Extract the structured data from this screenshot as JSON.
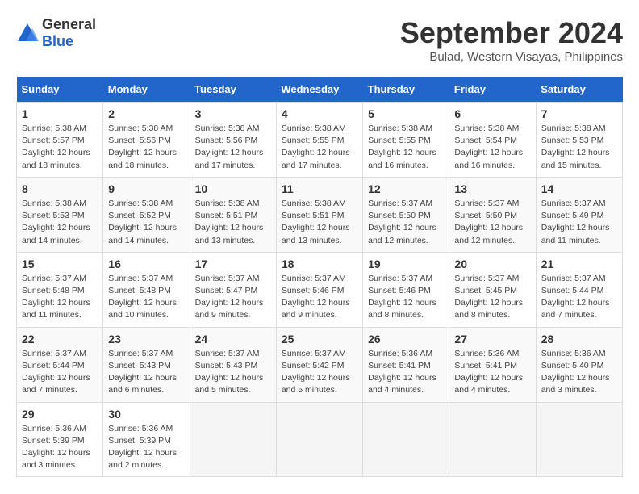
{
  "header": {
    "logo": {
      "general": "General",
      "blue": "Blue"
    },
    "title": "September 2024",
    "location": "Bulad, Western Visayas, Philippines"
  },
  "calendar": {
    "days_of_week": [
      "Sunday",
      "Monday",
      "Tuesday",
      "Wednesday",
      "Thursday",
      "Friday",
      "Saturday"
    ],
    "weeks": [
      [
        {
          "date": null,
          "info": null
        },
        {
          "date": null,
          "info": null
        },
        {
          "date": null,
          "info": null
        },
        {
          "date": null,
          "info": null
        },
        {
          "date": null,
          "info": null
        },
        {
          "date": null,
          "info": null
        },
        {
          "date": null,
          "info": null
        }
      ],
      [
        {
          "date": "1",
          "info": "Sunrise: 5:38 AM\nSunset: 5:57 PM\nDaylight: 12 hours and 18 minutes."
        },
        {
          "date": "2",
          "info": "Sunrise: 5:38 AM\nSunset: 5:56 PM\nDaylight: 12 hours and 18 minutes."
        },
        {
          "date": "3",
          "info": "Sunrise: 5:38 AM\nSunset: 5:56 PM\nDaylight: 12 hours and 17 minutes."
        },
        {
          "date": "4",
          "info": "Sunrise: 5:38 AM\nSunset: 5:55 PM\nDaylight: 12 hours and 17 minutes."
        },
        {
          "date": "5",
          "info": "Sunrise: 5:38 AM\nSunset: 5:55 PM\nDaylight: 12 hours and 16 minutes."
        },
        {
          "date": "6",
          "info": "Sunrise: 5:38 AM\nSunset: 5:54 PM\nDaylight: 12 hours and 16 minutes."
        },
        {
          "date": "7",
          "info": "Sunrise: 5:38 AM\nSunset: 5:53 PM\nDaylight: 12 hours and 15 minutes."
        }
      ],
      [
        {
          "date": "8",
          "info": "Sunrise: 5:38 AM\nSunset: 5:53 PM\nDaylight: 12 hours and 14 minutes."
        },
        {
          "date": "9",
          "info": "Sunrise: 5:38 AM\nSunset: 5:52 PM\nDaylight: 12 hours and 14 minutes."
        },
        {
          "date": "10",
          "info": "Sunrise: 5:38 AM\nSunset: 5:51 PM\nDaylight: 12 hours and 13 minutes."
        },
        {
          "date": "11",
          "info": "Sunrise: 5:38 AM\nSunset: 5:51 PM\nDaylight: 12 hours and 13 minutes."
        },
        {
          "date": "12",
          "info": "Sunrise: 5:37 AM\nSunset: 5:50 PM\nDaylight: 12 hours and 12 minutes."
        },
        {
          "date": "13",
          "info": "Sunrise: 5:37 AM\nSunset: 5:50 PM\nDaylight: 12 hours and 12 minutes."
        },
        {
          "date": "14",
          "info": "Sunrise: 5:37 AM\nSunset: 5:49 PM\nDaylight: 12 hours and 11 minutes."
        }
      ],
      [
        {
          "date": "15",
          "info": "Sunrise: 5:37 AM\nSunset: 5:48 PM\nDaylight: 12 hours and 11 minutes."
        },
        {
          "date": "16",
          "info": "Sunrise: 5:37 AM\nSunset: 5:48 PM\nDaylight: 12 hours and 10 minutes."
        },
        {
          "date": "17",
          "info": "Sunrise: 5:37 AM\nSunset: 5:47 PM\nDaylight: 12 hours and 9 minutes."
        },
        {
          "date": "18",
          "info": "Sunrise: 5:37 AM\nSunset: 5:46 PM\nDaylight: 12 hours and 9 minutes."
        },
        {
          "date": "19",
          "info": "Sunrise: 5:37 AM\nSunset: 5:46 PM\nDaylight: 12 hours and 8 minutes."
        },
        {
          "date": "20",
          "info": "Sunrise: 5:37 AM\nSunset: 5:45 PM\nDaylight: 12 hours and 8 minutes."
        },
        {
          "date": "21",
          "info": "Sunrise: 5:37 AM\nSunset: 5:44 PM\nDaylight: 12 hours and 7 minutes."
        }
      ],
      [
        {
          "date": "22",
          "info": "Sunrise: 5:37 AM\nSunset: 5:44 PM\nDaylight: 12 hours and 7 minutes."
        },
        {
          "date": "23",
          "info": "Sunrise: 5:37 AM\nSunset: 5:43 PM\nDaylight: 12 hours and 6 minutes."
        },
        {
          "date": "24",
          "info": "Sunrise: 5:37 AM\nSunset: 5:43 PM\nDaylight: 12 hours and 5 minutes."
        },
        {
          "date": "25",
          "info": "Sunrise: 5:37 AM\nSunset: 5:42 PM\nDaylight: 12 hours and 5 minutes."
        },
        {
          "date": "26",
          "info": "Sunrise: 5:36 AM\nSunset: 5:41 PM\nDaylight: 12 hours and 4 minutes."
        },
        {
          "date": "27",
          "info": "Sunrise: 5:36 AM\nSunset: 5:41 PM\nDaylight: 12 hours and 4 minutes."
        },
        {
          "date": "28",
          "info": "Sunrise: 5:36 AM\nSunset: 5:40 PM\nDaylight: 12 hours and 3 minutes."
        }
      ],
      [
        {
          "date": "29",
          "info": "Sunrise: 5:36 AM\nSunset: 5:39 PM\nDaylight: 12 hours and 3 minutes."
        },
        {
          "date": "30",
          "info": "Sunrise: 5:36 AM\nSunset: 5:39 PM\nDaylight: 12 hours and 2 minutes."
        },
        {
          "date": null,
          "info": null
        },
        {
          "date": null,
          "info": null
        },
        {
          "date": null,
          "info": null
        },
        {
          "date": null,
          "info": null
        },
        {
          "date": null,
          "info": null
        }
      ]
    ]
  }
}
